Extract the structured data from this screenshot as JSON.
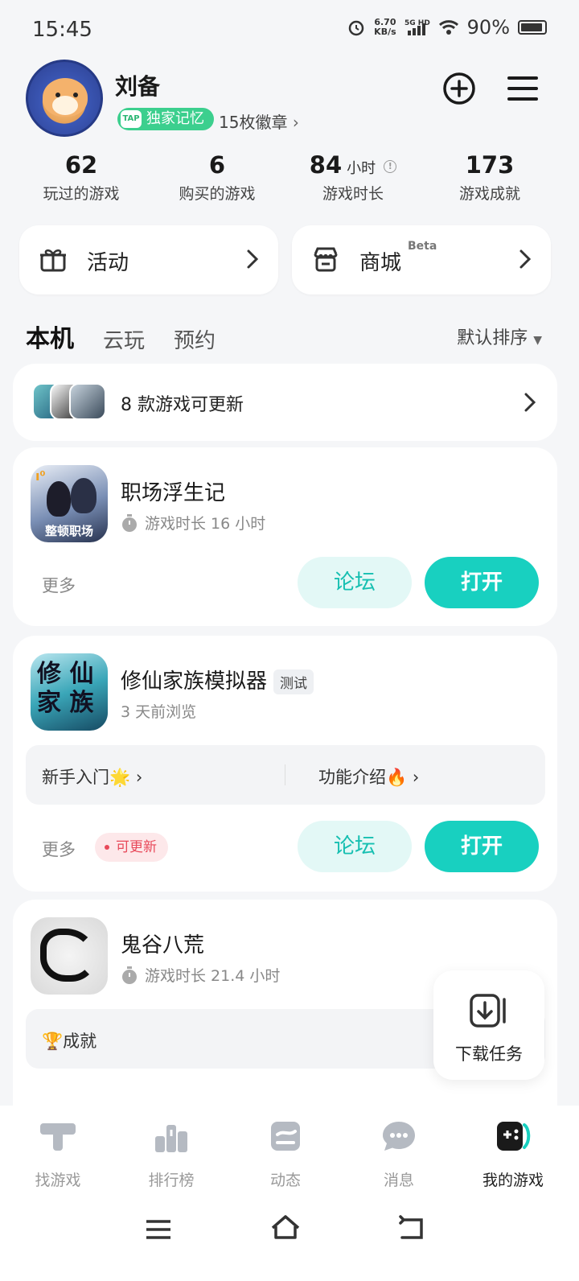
{
  "status": {
    "time": "15:45",
    "net_speed": "6.70",
    "net_unit": "KB/s",
    "net_type": "5G HD",
    "battery": "90%"
  },
  "profile": {
    "name": "刘备",
    "badge": "独家记忆",
    "badge_icon_text": "TAP",
    "medals": "15枚徽章"
  },
  "stats": [
    {
      "value": "62",
      "unit": "",
      "label": "玩过的游戏"
    },
    {
      "value": "6",
      "unit": "",
      "label": "购买的游戏"
    },
    {
      "value": "84",
      "unit": "小时",
      "label": "游戏时长"
    },
    {
      "value": "173",
      "unit": "",
      "label": "游戏成就"
    }
  ],
  "quick": {
    "activity": "活动",
    "shop": "商城",
    "shop_tag": "Beta"
  },
  "tabs": [
    "本机",
    "云玩",
    "预约"
  ],
  "sort": "默认排序",
  "updates": {
    "text": "8 款游戏可更新"
  },
  "games": [
    {
      "name": "职场浮生记",
      "sub": "游戏时长 16 小时",
      "icon_caption": "整顿职场",
      "more": "更多",
      "forum": "论坛",
      "open": "打开"
    },
    {
      "name": "修仙家族模拟器",
      "tag": "测试",
      "sub": "3 天前浏览",
      "guide1": "新手入门🌟",
      "guide2": "功能介绍🔥",
      "more": "更多",
      "update": "可更新",
      "forum": "论坛",
      "open": "打开"
    },
    {
      "name": "鬼谷八荒",
      "sub": "游戏时长 21.4 小时",
      "achievement": "🏆成就"
    }
  ],
  "download": "下载任务",
  "nav": [
    {
      "label": "找游戏",
      "icon": "find-game-icon"
    },
    {
      "label": "排行榜",
      "icon": "rank-icon"
    },
    {
      "label": "动态",
      "icon": "feed-icon"
    },
    {
      "label": "消息",
      "icon": "message-icon"
    },
    {
      "label": "我的游戏",
      "icon": "my-games-icon"
    }
  ],
  "colors": {
    "accent": "#18d0c0",
    "badge_green": "#3ccf8e",
    "update_red": "#e8495a"
  }
}
